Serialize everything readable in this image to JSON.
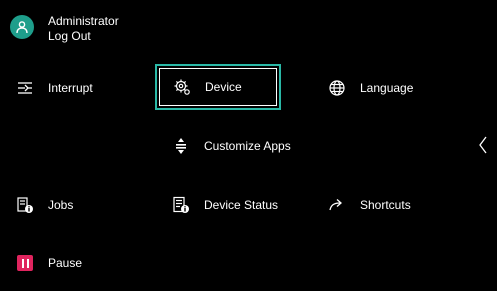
{
  "user": {
    "name": "Administrator",
    "logout_label": "Log Out"
  },
  "menu": {
    "interrupt": "Interrupt",
    "device": "Device",
    "language": "Language",
    "customize_apps": "Customize Apps",
    "jobs": "Jobs",
    "device_status": "Device Status",
    "shortcuts": "Shortcuts",
    "pause": "Pause"
  },
  "icons": {
    "avatar": "user-icon",
    "interrupt": "interrupt-icon",
    "device": "gear-icon",
    "language": "globe-icon",
    "customize_apps": "reorder-icon",
    "jobs": "jobs-icon",
    "device_status": "device-status-icon",
    "shortcuts": "share-arrow-icon",
    "pause": "pause-icon",
    "back": "chevron-left-icon"
  },
  "colors": {
    "background": "#000000",
    "accent": "#2ab8a6",
    "avatar": "#1e9e8b",
    "pause": "#e0245e",
    "text": "#ffffff"
  }
}
